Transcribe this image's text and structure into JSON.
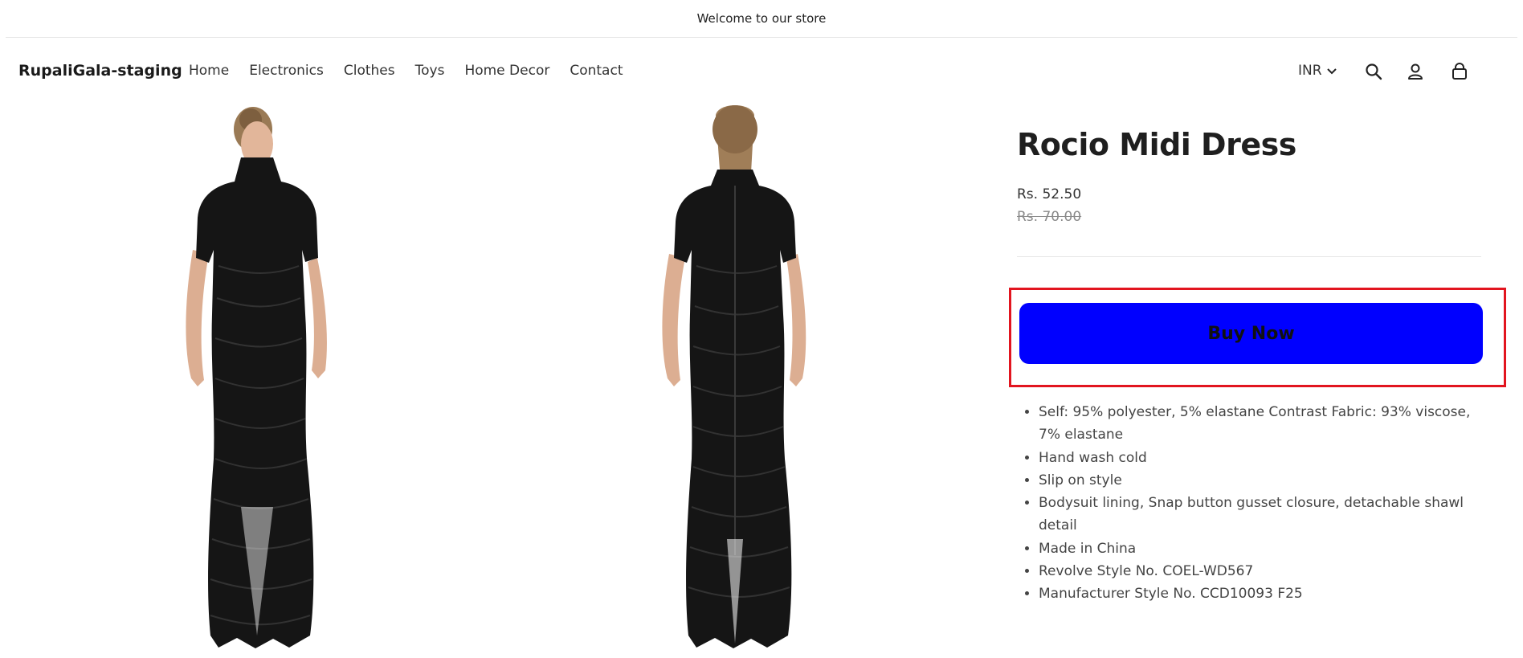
{
  "announcement": {
    "text": "Welcome to our store"
  },
  "header": {
    "logo": "RupaliGala-staging",
    "nav": [
      "Home",
      "Electronics",
      "Clothes",
      "Toys",
      "Home Decor",
      "Contact"
    ],
    "currency": "INR",
    "icons": [
      "search-icon",
      "account-icon",
      "cart-icon"
    ]
  },
  "gallery": {
    "images": [
      "dress-front-image",
      "dress-back-image"
    ]
  },
  "product": {
    "title": "Rocio Midi Dress",
    "sale_price": "Rs. 52.50",
    "regular_price": "Rs. 70.00",
    "buy_label": "Buy Now",
    "details": [
      "Self: 95% polyester, 5% elastane Contrast Fabric: 93% viscose, 7% elastane",
      "Hand wash cold",
      "Slip on style",
      "Bodysuit lining, Snap button gusset closure, detachable shawl detail",
      "Made in China",
      "Revolve Style No. COEL-WD567",
      "Manufacturer Style No. CCD10093 F25"
    ]
  },
  "colors": {
    "buy_button": "#0000ff",
    "highlight": "#e2151f",
    "dress": "#151515"
  }
}
